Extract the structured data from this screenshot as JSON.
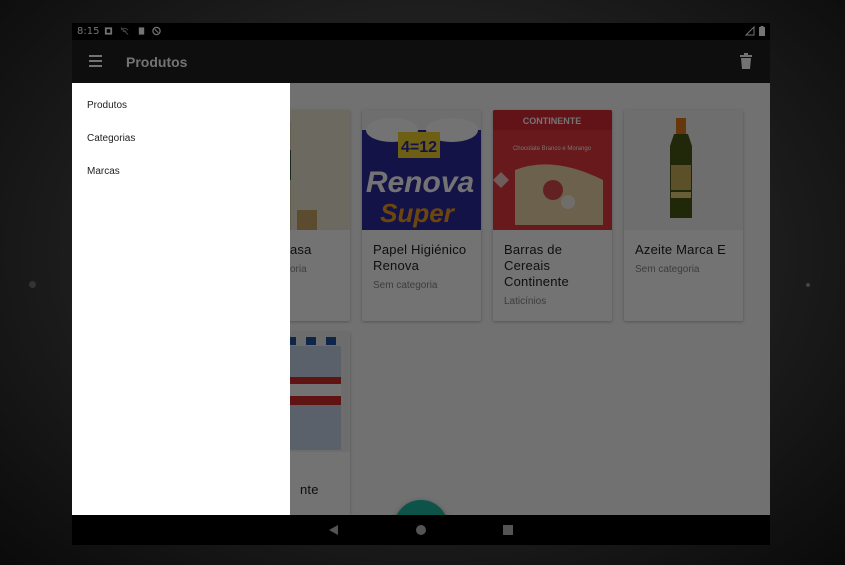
{
  "status_bar": {
    "time": "8:15"
  },
  "app_bar": {
    "title": "Produtos",
    "menu_icon": "hamburger-menu-icon",
    "action_icon": "trash-icon"
  },
  "drawer": {
    "items": [
      {
        "label": "Produtos"
      },
      {
        "label": "Categorias"
      },
      {
        "label": "Marcas"
      }
    ]
  },
  "products": [
    {
      "name": "",
      "name_partial": "asa",
      "category_partial": "oria"
    },
    {
      "name": "Papel Higiénico Renova",
      "category": "Sem categoria",
      "image_text_top": "4=12",
      "image_text_brand": "Renova",
      "image_text_sub": "Super"
    },
    {
      "name": "Barras de Cereais Continente",
      "category": "Laticínios",
      "image_text_brand": "CONTINENTE",
      "image_text_sub": "Chocolate Branco e Morango"
    },
    {
      "name": "Azeite Marca E",
      "category": "Sem categoria"
    },
    {
      "name_partial": "nte"
    }
  ],
  "fab": {
    "label": "+"
  },
  "colors": {
    "accent": "#1db9a4",
    "app_bar": "#212121",
    "status_bar": "#000000"
  }
}
